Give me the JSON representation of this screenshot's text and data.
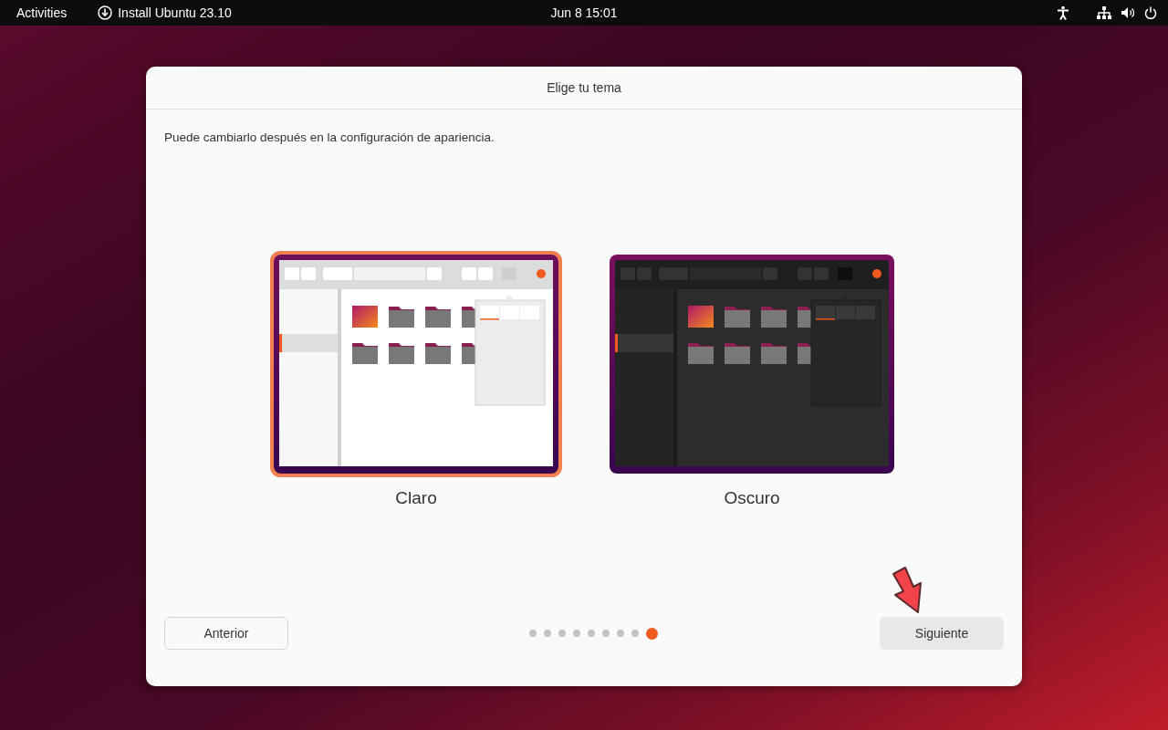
{
  "top_bar": {
    "activities": "Activities",
    "app": "Install Ubuntu 23.10",
    "clock": "Jun 8  15:01"
  },
  "dialog": {
    "title": "Elige tu tema",
    "subtitle": "Puede cambiarlo después en la configuración de apariencia.",
    "themes": [
      {
        "kind": "light",
        "label": "Claro",
        "selected": true
      },
      {
        "kind": "dark",
        "label": "Oscuro",
        "selected": false
      }
    ],
    "back_button": "Anterior",
    "next_button": "Siguiente",
    "steps": [
      {
        "selected": false
      },
      {
        "selected": false
      },
      {
        "selected": false
      },
      {
        "selected": false
      },
      {
        "selected": false
      },
      {
        "selected": false
      },
      {
        "selected": false
      },
      {
        "selected": false
      },
      {
        "selected": true
      }
    ]
  }
}
